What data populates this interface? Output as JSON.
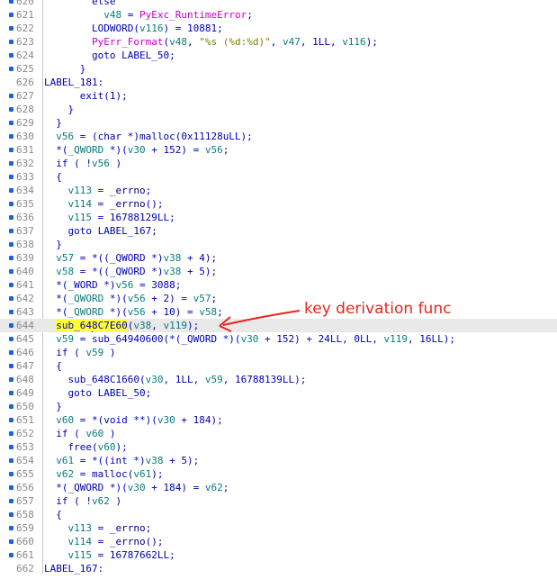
{
  "annotation": {
    "text": "key derivation func",
    "color": "#e8261e"
  },
  "cursor_line": 644,
  "lines": [
    {
      "n": "620",
      "dot": true,
      "hl": false,
      "t": [
        {
          "c": "t-p",
          "x": "        else"
        }
      ]
    },
    {
      "n": "621",
      "dot": true,
      "hl": false,
      "t": [
        {
          "c": "t-p",
          "x": "          "
        },
        {
          "c": "t-v",
          "x": "v48"
        },
        {
          "c": "t-p",
          "x": " = "
        },
        {
          "c": "t-e",
          "x": "PyExc_RuntimeError"
        },
        {
          "c": "t-p",
          "x": ";"
        }
      ]
    },
    {
      "n": "622",
      "dot": true,
      "hl": false,
      "t": [
        {
          "c": "t-p",
          "x": "        LODWORD("
        },
        {
          "c": "t-v",
          "x": "v116"
        },
        {
          "c": "t-p",
          "x": ") = 10881;"
        }
      ]
    },
    {
      "n": "623",
      "dot": true,
      "hl": false,
      "t": [
        {
          "c": "t-p",
          "x": "        "
        },
        {
          "c": "t-e",
          "x": "PyErr_Format"
        },
        {
          "c": "t-p",
          "x": "("
        },
        {
          "c": "t-v",
          "x": "v48"
        },
        {
          "c": "t-p",
          "x": ", "
        },
        {
          "c": "t-s",
          "x": "\"%s (%d:%d)\""
        },
        {
          "c": "t-p",
          "x": ", "
        },
        {
          "c": "t-v",
          "x": "v47"
        },
        {
          "c": "t-p",
          "x": ", 1LL, "
        },
        {
          "c": "t-v",
          "x": "v116"
        },
        {
          "c": "t-p",
          "x": ");"
        }
      ]
    },
    {
      "n": "624",
      "dot": true,
      "hl": false,
      "t": [
        {
          "c": "t-p",
          "x": "        goto LABEL_50;"
        }
      ]
    },
    {
      "n": "625",
      "dot": true,
      "hl": false,
      "t": [
        {
          "c": "t-p",
          "x": "      }"
        }
      ]
    },
    {
      "n": "626",
      "dot": false,
      "hl": false,
      "t": [
        {
          "c": "t-p",
          "x": "LABEL_181:"
        }
      ]
    },
    {
      "n": "627",
      "dot": true,
      "hl": false,
      "t": [
        {
          "c": "t-p",
          "x": "      exit(1);"
        }
      ]
    },
    {
      "n": "628",
      "dot": true,
      "hl": false,
      "t": [
        {
          "c": "t-p",
          "x": "    }"
        }
      ]
    },
    {
      "n": "629",
      "dot": true,
      "hl": false,
      "t": [
        {
          "c": "t-p",
          "x": "  }"
        }
      ]
    },
    {
      "n": "630",
      "dot": true,
      "hl": false,
      "t": [
        {
          "c": "t-p",
          "x": "  "
        },
        {
          "c": "t-v",
          "x": "v56"
        },
        {
          "c": "t-p",
          "x": " = (char *)malloc(0x11128uLL);"
        }
      ]
    },
    {
      "n": "631",
      "dot": true,
      "hl": false,
      "t": [
        {
          "c": "t-p",
          "x": "  *("
        },
        {
          "c": "t-v",
          "x": "_QWORD"
        },
        {
          "c": "t-p",
          "x": " *)("
        },
        {
          "c": "t-v",
          "x": "v30"
        },
        {
          "c": "t-p",
          "x": " + 152) = "
        },
        {
          "c": "t-v",
          "x": "v56"
        },
        {
          "c": "t-p",
          "x": ";"
        }
      ]
    },
    {
      "n": "632",
      "dot": true,
      "hl": false,
      "t": [
        {
          "c": "t-p",
          "x": "  if ( !"
        },
        {
          "c": "t-v",
          "x": "v56"
        },
        {
          "c": "t-p",
          "x": " )"
        }
      ]
    },
    {
      "n": "633",
      "dot": true,
      "hl": false,
      "t": [
        {
          "c": "t-p",
          "x": "  {"
        }
      ]
    },
    {
      "n": "634",
      "dot": true,
      "hl": false,
      "t": [
        {
          "c": "t-p",
          "x": "    "
        },
        {
          "c": "t-v",
          "x": "v113"
        },
        {
          "c": "t-p",
          "x": " = "
        },
        {
          "c": "t-n",
          "x": "_errno"
        },
        {
          "c": "t-p",
          "x": ";"
        }
      ]
    },
    {
      "n": "635",
      "dot": true,
      "hl": false,
      "t": [
        {
          "c": "t-p",
          "x": "    "
        },
        {
          "c": "t-v",
          "x": "v114"
        },
        {
          "c": "t-p",
          "x": " = "
        },
        {
          "c": "t-n",
          "x": "_errno"
        },
        {
          "c": "t-p",
          "x": "();"
        }
      ]
    },
    {
      "n": "636",
      "dot": true,
      "hl": false,
      "t": [
        {
          "c": "t-p",
          "x": "    "
        },
        {
          "c": "t-v",
          "x": "v115"
        },
        {
          "c": "t-p",
          "x": " = 16788129LL;"
        }
      ]
    },
    {
      "n": "637",
      "dot": true,
      "hl": false,
      "t": [
        {
          "c": "t-p",
          "x": "    goto LABEL_167;"
        }
      ]
    },
    {
      "n": "638",
      "dot": true,
      "hl": false,
      "t": [
        {
          "c": "t-p",
          "x": "  }"
        }
      ]
    },
    {
      "n": "639",
      "dot": true,
      "hl": false,
      "t": [
        {
          "c": "t-p",
          "x": "  "
        },
        {
          "c": "t-v",
          "x": "v57"
        },
        {
          "c": "t-p",
          "x": " = *((_QWORD *)"
        },
        {
          "c": "t-v",
          "x": "v38"
        },
        {
          "c": "t-p",
          "x": " + 4);"
        }
      ]
    },
    {
      "n": "640",
      "dot": true,
      "hl": false,
      "t": [
        {
          "c": "t-p",
          "x": "  "
        },
        {
          "c": "t-v",
          "x": "v58"
        },
        {
          "c": "t-p",
          "x": " = *((_QWORD *)"
        },
        {
          "c": "t-v",
          "x": "v38"
        },
        {
          "c": "t-p",
          "x": " + 5);"
        }
      ]
    },
    {
      "n": "641",
      "dot": true,
      "hl": false,
      "t": [
        {
          "c": "t-p",
          "x": "  *(_WORD *)"
        },
        {
          "c": "t-v",
          "x": "v56"
        },
        {
          "c": "t-p",
          "x": " = 3088;"
        }
      ]
    },
    {
      "n": "642",
      "dot": true,
      "hl": false,
      "t": [
        {
          "c": "t-p",
          "x": "  *("
        },
        {
          "c": "t-v",
          "x": "_QWORD"
        },
        {
          "c": "t-p",
          "x": " *)("
        },
        {
          "c": "t-v",
          "x": "v56"
        },
        {
          "c": "t-p",
          "x": " + 2) = "
        },
        {
          "c": "t-v",
          "x": "v57"
        },
        {
          "c": "t-p",
          "x": ";"
        }
      ]
    },
    {
      "n": "643",
      "dot": true,
      "hl": false,
      "t": [
        {
          "c": "t-p",
          "x": "  *("
        },
        {
          "c": "t-v",
          "x": "_QWORD"
        },
        {
          "c": "t-p",
          "x": " *)("
        },
        {
          "c": "t-v",
          "x": "v56"
        },
        {
          "c": "t-p",
          "x": " + 10) = "
        },
        {
          "c": "t-v",
          "x": "v58"
        },
        {
          "c": "t-p",
          "x": ";"
        }
      ]
    },
    {
      "n": "644",
      "dot": true,
      "hl": true,
      "t": [
        {
          "c": "t-p",
          "x": "  "
        },
        {
          "c": "t-h",
          "x": "sub_64"
        },
        {
          "c": "caret",
          "x": ""
        },
        {
          "c": "t-h",
          "x": "8C7E60"
        },
        {
          "c": "t-p",
          "x": "("
        },
        {
          "c": "t-v",
          "x": "v38"
        },
        {
          "c": "t-p",
          "x": ", "
        },
        {
          "c": "t-v",
          "x": "v119"
        },
        {
          "c": "t-p",
          "x": ");"
        }
      ]
    },
    {
      "n": "645",
      "dot": true,
      "hl": false,
      "t": [
        {
          "c": "t-p",
          "x": "  "
        },
        {
          "c": "t-v",
          "x": "v59"
        },
        {
          "c": "t-p",
          "x": " = sub_64940600(*(_QWORD *)("
        },
        {
          "c": "t-v",
          "x": "v30"
        },
        {
          "c": "t-p",
          "x": " + 152) + 24LL, 0LL, "
        },
        {
          "c": "t-v",
          "x": "v119"
        },
        {
          "c": "t-p",
          "x": ", 16LL);"
        }
      ]
    },
    {
      "n": "646",
      "dot": true,
      "hl": false,
      "t": [
        {
          "c": "t-p",
          "x": "  if ( "
        },
        {
          "c": "t-v",
          "x": "v59"
        },
        {
          "c": "t-p",
          "x": " )"
        }
      ]
    },
    {
      "n": "647",
      "dot": true,
      "hl": false,
      "t": [
        {
          "c": "t-p",
          "x": "  {"
        }
      ]
    },
    {
      "n": "648",
      "dot": true,
      "hl": false,
      "t": [
        {
          "c": "t-p",
          "x": "    sub_648C1660("
        },
        {
          "c": "t-v",
          "x": "v30"
        },
        {
          "c": "t-p",
          "x": ", 1LL, "
        },
        {
          "c": "t-v",
          "x": "v59"
        },
        {
          "c": "t-p",
          "x": ", 16788139LL);"
        }
      ]
    },
    {
      "n": "649",
      "dot": true,
      "hl": false,
      "t": [
        {
          "c": "t-p",
          "x": "    goto LABEL_50;"
        }
      ]
    },
    {
      "n": "650",
      "dot": true,
      "hl": false,
      "t": [
        {
          "c": "t-p",
          "x": "  }"
        }
      ]
    },
    {
      "n": "651",
      "dot": true,
      "hl": false,
      "t": [
        {
          "c": "t-p",
          "x": "  "
        },
        {
          "c": "t-v",
          "x": "v60"
        },
        {
          "c": "t-p",
          "x": " = *(void **)("
        },
        {
          "c": "t-v",
          "x": "v30"
        },
        {
          "c": "t-p",
          "x": " + 184);"
        }
      ]
    },
    {
      "n": "652",
      "dot": true,
      "hl": false,
      "t": [
        {
          "c": "t-p",
          "x": "  if ( "
        },
        {
          "c": "t-v",
          "x": "v60"
        },
        {
          "c": "t-p",
          "x": " )"
        }
      ]
    },
    {
      "n": "653",
      "dot": true,
      "hl": false,
      "t": [
        {
          "c": "t-p",
          "x": "    free("
        },
        {
          "c": "t-v",
          "x": "v60"
        },
        {
          "c": "t-p",
          "x": ");"
        }
      ]
    },
    {
      "n": "654",
      "dot": true,
      "hl": false,
      "t": [
        {
          "c": "t-p",
          "x": "  "
        },
        {
          "c": "t-v",
          "x": "v61"
        },
        {
          "c": "t-p",
          "x": " = *((int *)"
        },
        {
          "c": "t-v",
          "x": "v38"
        },
        {
          "c": "t-p",
          "x": " + 5);"
        }
      ]
    },
    {
      "n": "655",
      "dot": true,
      "hl": false,
      "t": [
        {
          "c": "t-p",
          "x": "  "
        },
        {
          "c": "t-v",
          "x": "v62"
        },
        {
          "c": "t-p",
          "x": " = malloc("
        },
        {
          "c": "t-v",
          "x": "v61"
        },
        {
          "c": "t-p",
          "x": ");"
        }
      ]
    },
    {
      "n": "656",
      "dot": true,
      "hl": false,
      "t": [
        {
          "c": "t-p",
          "x": "  *(_QWORD *)("
        },
        {
          "c": "t-v",
          "x": "v30"
        },
        {
          "c": "t-p",
          "x": " + 184) = "
        },
        {
          "c": "t-v",
          "x": "v62"
        },
        {
          "c": "t-p",
          "x": ";"
        }
      ]
    },
    {
      "n": "657",
      "dot": true,
      "hl": false,
      "t": [
        {
          "c": "t-p",
          "x": "  if ( !"
        },
        {
          "c": "t-v",
          "x": "v62"
        },
        {
          "c": "t-p",
          "x": " )"
        }
      ]
    },
    {
      "n": "658",
      "dot": true,
      "hl": false,
      "t": [
        {
          "c": "t-p",
          "x": "  {"
        }
      ]
    },
    {
      "n": "659",
      "dot": true,
      "hl": false,
      "t": [
        {
          "c": "t-p",
          "x": "    "
        },
        {
          "c": "t-v",
          "x": "v113"
        },
        {
          "c": "t-p",
          "x": " = "
        },
        {
          "c": "t-n",
          "x": "_errno"
        },
        {
          "c": "t-p",
          "x": ";"
        }
      ]
    },
    {
      "n": "660",
      "dot": true,
      "hl": false,
      "t": [
        {
          "c": "t-p",
          "x": "    "
        },
        {
          "c": "t-v",
          "x": "v114"
        },
        {
          "c": "t-p",
          "x": " = "
        },
        {
          "c": "t-n",
          "x": "_errno"
        },
        {
          "c": "t-p",
          "x": "();"
        }
      ]
    },
    {
      "n": "661",
      "dot": true,
      "hl": false,
      "t": [
        {
          "c": "t-p",
          "x": "    "
        },
        {
          "c": "t-v",
          "x": "v115"
        },
        {
          "c": "t-p",
          "x": " = 16787662LL;"
        }
      ]
    },
    {
      "n": "662",
      "dot": false,
      "hl": false,
      "t": [
        {
          "c": "t-p",
          "x": "LABEL_167:"
        }
      ]
    }
  ]
}
